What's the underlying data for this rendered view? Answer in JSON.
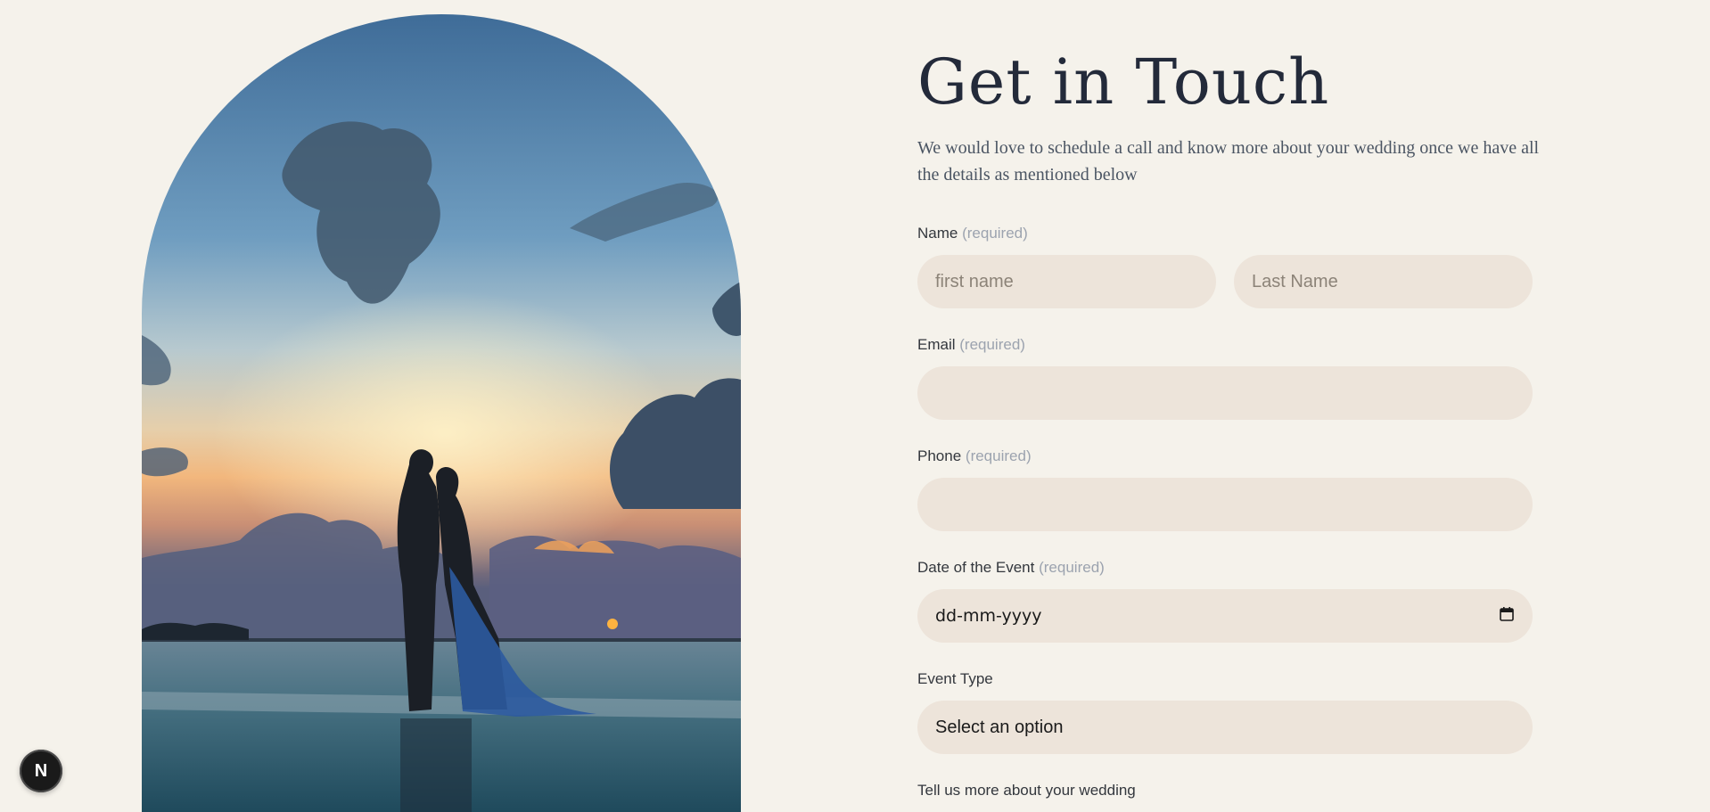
{
  "form": {
    "title": "Get in Touch",
    "subtitle": "We would love to schedule a call and know more about your wedding once we have all the details as mentioned below",
    "required_text": "(required)",
    "name": {
      "label": "Name",
      "first_placeholder": "first name",
      "last_placeholder": "Last Name"
    },
    "email": {
      "label": "Email"
    },
    "phone": {
      "label": "Phone"
    },
    "date": {
      "label": "Date of the Event",
      "value": "dd-mm-yyyy"
    },
    "event_type": {
      "label": "Event Type",
      "value": "Select an option"
    },
    "more": {
      "label": "Tell us more about your wedding"
    }
  },
  "badge": {
    "letter": "N"
  },
  "colors": {
    "background": "#f5f2eb",
    "field": "#ede4da",
    "heading": "#232a3a"
  }
}
